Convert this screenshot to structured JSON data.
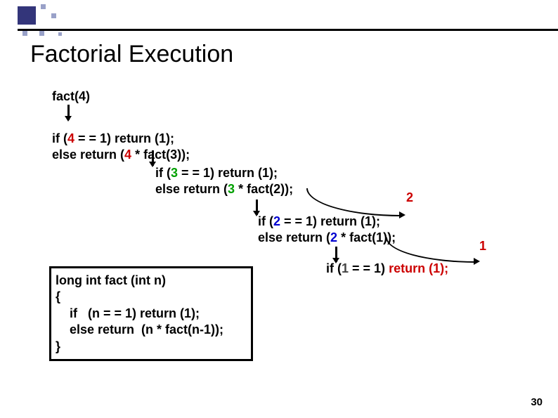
{
  "title": "Factorial Execution",
  "trace": {
    "call": "fact(4)",
    "step1": {
      "if": "if   (",
      "n": "4",
      "cond": " = = 1) return (1);",
      "else": "else return  (",
      "mult": " * fact(3));"
    },
    "step2": {
      "if": "if   (",
      "n": "3",
      "cond": " = = 1) return (1);",
      "else": "else return  (",
      "mult": " * fact(2));"
    },
    "step3": {
      "if": "if   (",
      "n": "2",
      "cond": " = = 1) return (1);",
      "else": "else return  (",
      "mult": " * fact(1));"
    },
    "step4": {
      "if": "if   (",
      "n": "1",
      "cond": " = = 1) ",
      "ret": "return (1);"
    },
    "returns": {
      "r2": "2",
      "r1": "1"
    }
  },
  "code": {
    "l1": "long  int  fact (int n)",
    "l2": "{",
    "l3": "    if   (n = = 1) return (1);",
    "l4": "    else return  (n * fact(n-1));",
    "l5": "}"
  },
  "page_number": "30"
}
